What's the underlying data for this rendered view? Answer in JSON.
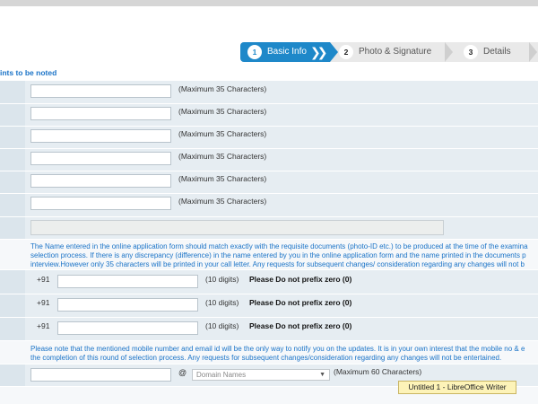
{
  "steps": [
    {
      "num": "1",
      "label": "Basic Info"
    },
    {
      "num": "2",
      "label": "Photo & Signature"
    },
    {
      "num": "3",
      "label": "Details"
    }
  ],
  "points_note": "ints to be noted",
  "name_fields": [
    {
      "hint": "(Maximum 35 Characters)"
    },
    {
      "hint": "(Maximum 35 Characters)"
    },
    {
      "hint": "(Maximum 35 Characters)"
    },
    {
      "hint": "(Maximum 35 Characters)"
    },
    {
      "hint": "(Maximum 35 Characters)"
    },
    {
      "hint": "(Maximum 35 Characters)"
    }
  ],
  "name_info": [
    "The Name entered in the online application form should match exactly with the requisite documents (photo-ID etc.) to be produced at the time of the examina",
    "selection process. If there is any discrepancy (difference) in the name entered by you in the online application form and the name printed in the documents p",
    "interview.However only 35 characters will be printed in your call letter. Any requests for subsequent changes/ consideration regarding any changes will not b"
  ],
  "mobile_fields": [
    {
      "prefix": "+91",
      "digits": "(10 digits)",
      "note": "Please Do not prefix zero (0)"
    },
    {
      "prefix": "+91",
      "digits": "(10 digits)",
      "note": "Please Do not prefix zero (0)"
    },
    {
      "prefix": "+91",
      "digits": "(10 digits)",
      "note": "Please Do not prefix zero (0)"
    }
  ],
  "mobile_info": [
    "Please note that the mentioned mobile number and email id will be the only way to notify you on the updates. It is in your own interest that the mobile no & e",
    "the completion of this round of selection process. Any requests for subsequent changes/consideration regarding any changes will not be entertained."
  ],
  "email": {
    "at": "@",
    "domain_placeholder": "Domain Names",
    "hint": "(Maximum 60 Characters)"
  },
  "taskbar_tooltip": "Untitled 1 - LibreOffice Writer",
  "colors": {
    "accent": "#1e88c9",
    "info_text": "#1a73c7"
  }
}
